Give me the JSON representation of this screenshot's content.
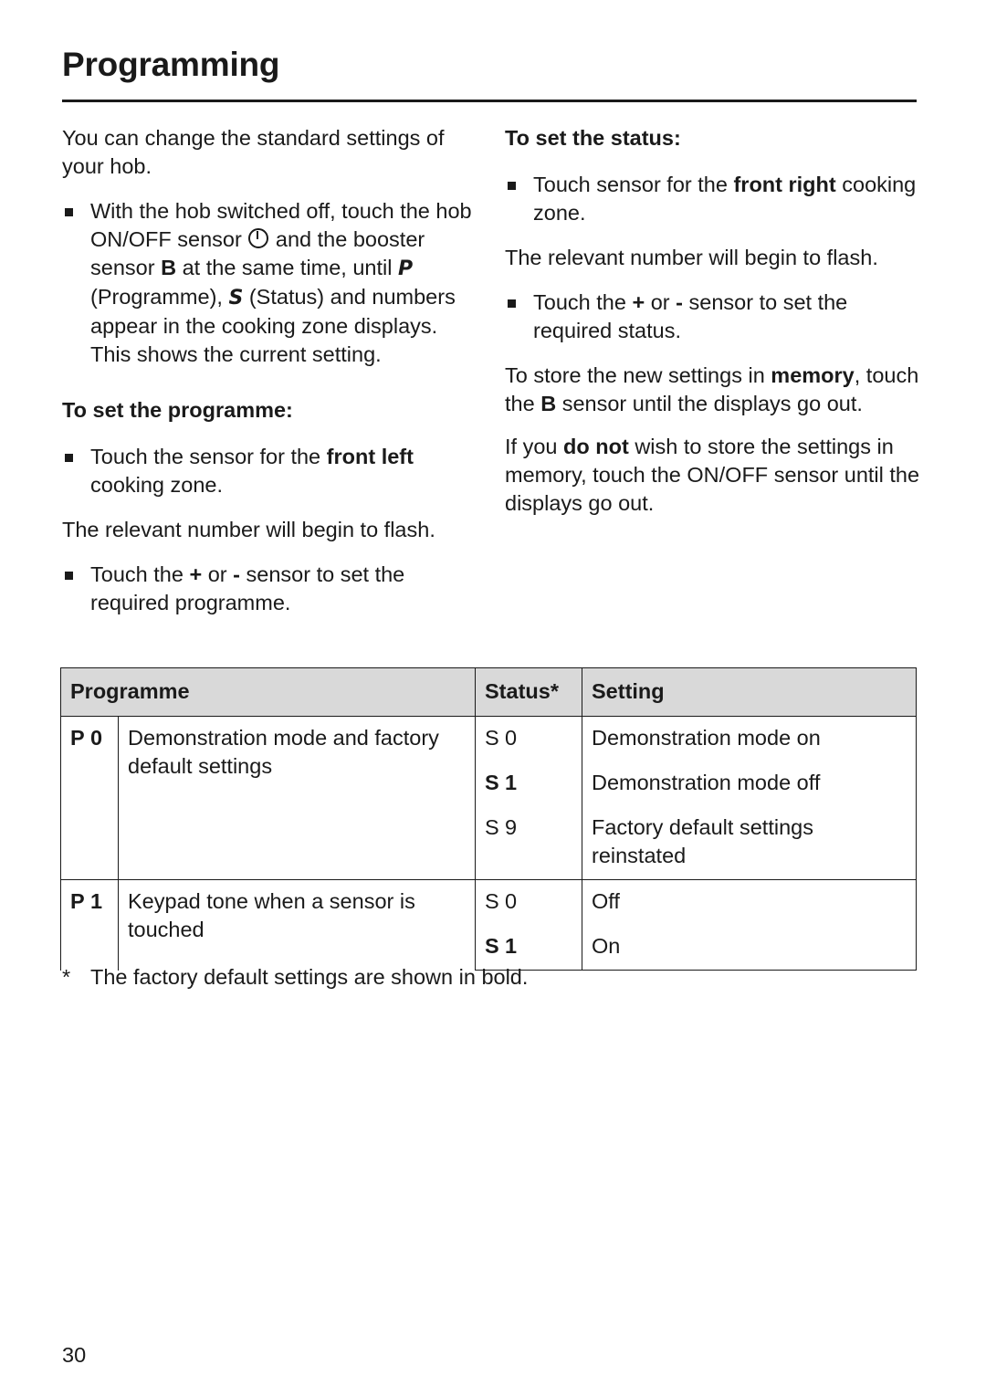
{
  "page": {
    "title": "Programming",
    "number": "30"
  },
  "left_column": {
    "intro": "You can change the standard settings of your hob.",
    "bullet1_parts": {
      "a": "With the hob switched off, touch the hob ON/OFF sensor",
      "b": "and the booster sensor",
      "c": "B",
      "d": "at the same time, until",
      "e": "P",
      "f": "(Programme),",
      "g": "S",
      "h": "(Status) and numbers appear in the cooking zone displays. This shows the current setting."
    },
    "subhead": "To set the programme:",
    "bullet2_parts": {
      "a": "Touch the sensor for the",
      "b": "front left",
      "c": "cooking zone."
    },
    "flash_text": "The relevant number will begin to flash.",
    "bullet3_parts": {
      "a": "Touch the",
      "b": "+",
      "c": "or",
      "d": "-",
      "e": "sensor to set the required programme."
    }
  },
  "right_column": {
    "subhead": "To set the status:",
    "bullet1_parts": {
      "a": "Touch sensor for the",
      "b": "front right",
      "c": "cooking zone."
    },
    "flash_text": "The relevant number will begin to flash.",
    "bullet2_parts": {
      "a": "Touch the",
      "b": "+",
      "c": "or",
      "d": "-",
      "e": "sensor to set the required status."
    },
    "store_parts": {
      "a": "To store the new settings in",
      "b": "memory",
      "c": ", touch the",
      "d": "B",
      "e": "sensor until the displays go out."
    },
    "donot_parts": {
      "a": "If you",
      "b": "do not",
      "c": "wish to store the settings in memory, touch the ON/OFF sensor until the displays go out."
    }
  },
  "table": {
    "headers": {
      "programme": "Programme",
      "status": "Status*",
      "setting": "Setting"
    },
    "rows": [
      {
        "p_letter": "P",
        "p_number": "0",
        "description": "Demonstration mode and factory default settings",
        "statuses": [
          {
            "letter": "S",
            "number": "0",
            "bold": false,
            "setting": "Demonstration mode on"
          },
          {
            "letter": "S",
            "number": "1",
            "bold": true,
            "setting": "Demonstration mode off"
          },
          {
            "letter": "S",
            "number": "9",
            "bold": false,
            "setting": "Factory default settings reinstated"
          }
        ]
      },
      {
        "p_letter": "P",
        "p_number": "1",
        "description": "Keypad tone when a sensor is touched",
        "statuses": [
          {
            "letter": "S",
            "number": "0",
            "bold": false,
            "setting": "Off"
          },
          {
            "letter": "S",
            "number": "1",
            "bold": true,
            "setting": "On"
          }
        ]
      }
    ]
  },
  "footnote": {
    "marker": "*",
    "text": "The factory default settings are shown in bold."
  }
}
